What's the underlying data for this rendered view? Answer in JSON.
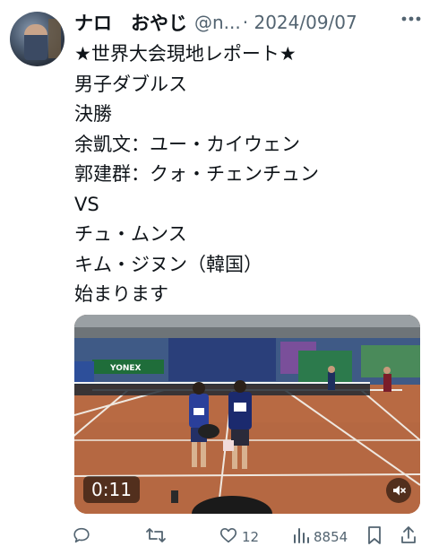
{
  "author": {
    "display_name": "ナロ　おやじ",
    "handle": "@n...",
    "date": "· 2024/09/07"
  },
  "tweet": {
    "lines": [
      "★世界大会現地レポート★",
      "男子ダブルス",
      "決勝",
      "余凱文：ユー・カイウェン",
      "郭建群：クォ・チェンチュン",
      "VS",
      "チュ・ムンス",
      "キム・ジヌン（韓国）",
      "始まります"
    ]
  },
  "video": {
    "duration": "0:11",
    "sponsor": "YONEX",
    "muted": true
  },
  "actions": {
    "reply_count": "",
    "retweet_count": "",
    "like_count": "12",
    "view_count": "8854"
  },
  "colors": {
    "text": "#0f1419",
    "secondary": "#536471",
    "court": "#b86a43"
  },
  "icons": [
    "more-icon",
    "reply-icon",
    "retweet-icon",
    "like-icon",
    "views-icon",
    "bookmark-icon",
    "share-icon",
    "mute-icon"
  ]
}
